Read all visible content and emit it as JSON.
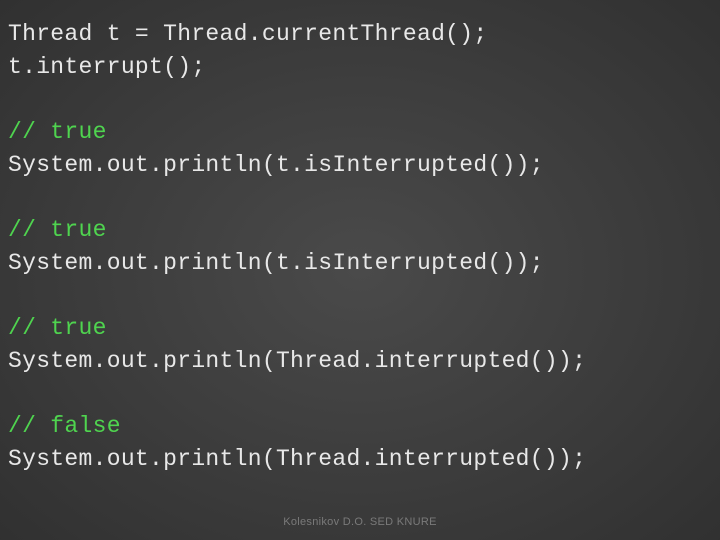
{
  "lines": [
    {
      "text": "Thread t = Thread.currentThread();",
      "type": "code"
    },
    {
      "text": "t.interrupt();",
      "type": "code"
    },
    {
      "text": "",
      "type": "blank"
    },
    {
      "text": "// true",
      "type": "comment"
    },
    {
      "text": "System.out.println(t.isInterrupted());",
      "type": "code"
    },
    {
      "text": "",
      "type": "blank"
    },
    {
      "text": "// true",
      "type": "comment"
    },
    {
      "text": "System.out.println(t.isInterrupted());",
      "type": "code"
    },
    {
      "text": "",
      "type": "blank"
    },
    {
      "text": "// true",
      "type": "comment"
    },
    {
      "text": "System.out.println(Thread.interrupted());",
      "type": "code"
    },
    {
      "text": "",
      "type": "blank"
    },
    {
      "text": "// false",
      "type": "comment"
    },
    {
      "text": "System.out.println(Thread.interrupted());",
      "type": "code"
    }
  ],
  "footer": "Kolesnikov D.O. SED KNURE"
}
